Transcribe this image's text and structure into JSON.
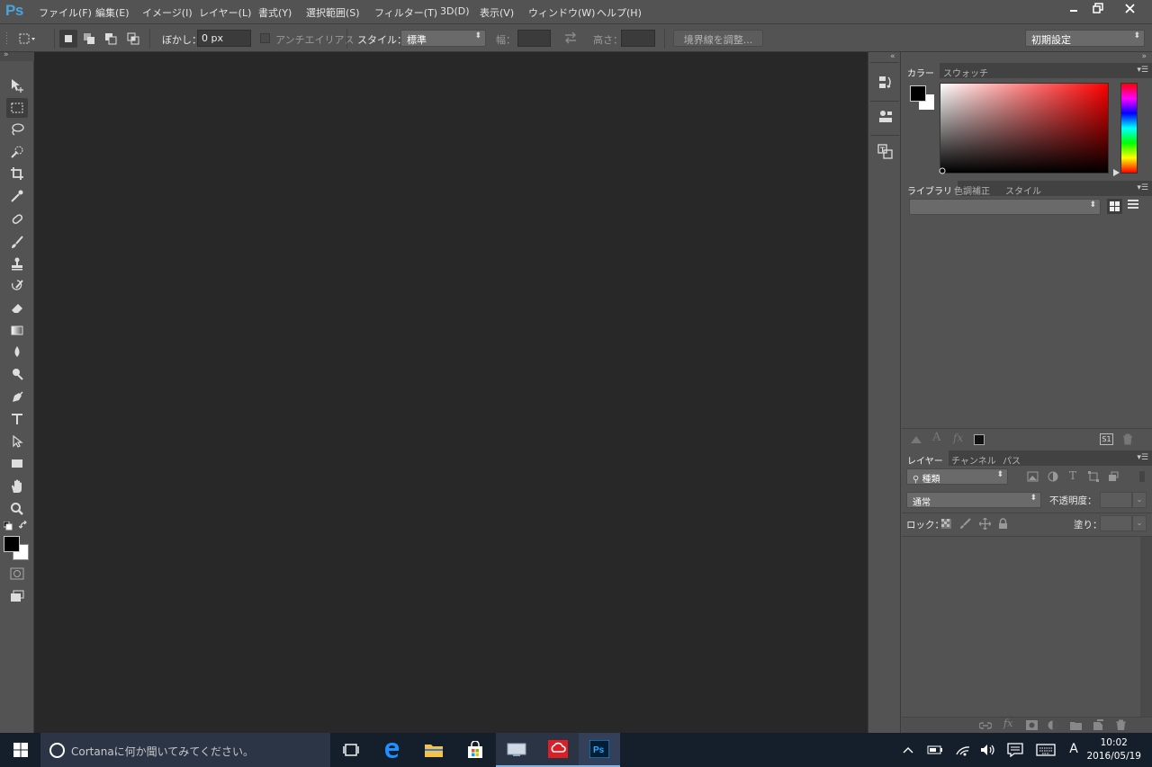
{
  "app": {
    "logo": "Ps"
  },
  "menu": [
    "ファイル(F)",
    "編集(E)",
    "イメージ(I)",
    "レイヤー(L)",
    "書式(Y)",
    "選択範囲(S)",
    "フィルター(T)",
    "3D(D)",
    "表示(V)",
    "ウィンドウ(W)",
    "ヘルプ(H)"
  ],
  "options": {
    "feather_label": "ぼかし：",
    "feather_value": "0 px",
    "antialias_label": "アンチエイリアス",
    "style_label": "スタイル：",
    "style_value": "標準",
    "width_label": "幅：",
    "height_label": "高さ：",
    "refine_edge_button": "境界線を調整...",
    "workspace": "初期設定"
  },
  "panels": {
    "color": {
      "tabs": [
        "カラー",
        "スウォッチ"
      ]
    },
    "libraries": {
      "tabs": [
        "ライブラリ",
        "色調補正",
        "スタイル"
      ],
      "footer_badge": "S1"
    },
    "layers": {
      "tabs": [
        "レイヤー",
        "チャンネル",
        "パス"
      ],
      "filter_label": "種類",
      "blend_mode": "通常",
      "opacity_label": "不透明度：",
      "lock_label": "ロック：",
      "fill_label": "塗り："
    }
  },
  "taskbar": {
    "search_placeholder": "Cortanaに何か聞いてみてください。",
    "ime": "A",
    "time": "10:02",
    "date": "2016/05/19"
  },
  "colors": {
    "foreground": "#000000",
    "background": "#ffffff",
    "picker_hue": "#ff0000",
    "ps_blue": "#4aa3df"
  }
}
